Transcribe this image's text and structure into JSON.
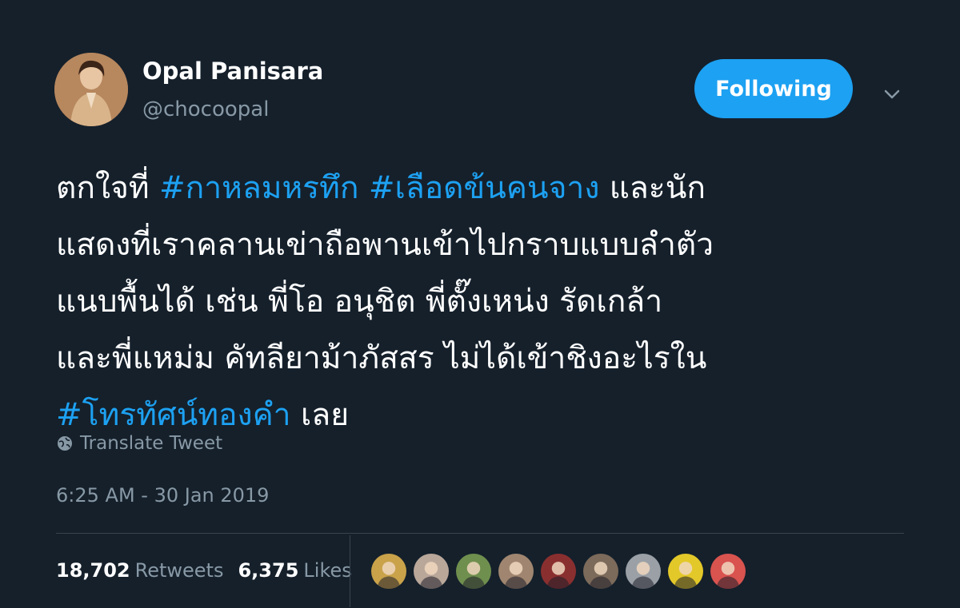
{
  "author": {
    "name": "Opal Panisara",
    "handle": "@chocoopal",
    "avatar_icon": "profile-photo"
  },
  "follow_button": {
    "label": "Following",
    "color": "#1da1f2"
  },
  "menu": {
    "icon": "chevron-down-icon"
  },
  "tweet": {
    "line1": {
      "text_a": "ตกใจที่ ",
      "tag_a": "#กาหลมหรทึก",
      "sep": " ",
      "tag_b": "#เลือดข้นคนจาง",
      "text_b": " และนัก"
    },
    "line2": "แสดงที่เราคลานเข่าถือพานเข้าไปกราบแบบลำตัว",
    "line3": "แนบพื้นได้ เช่น พี่โอ อนุชิต  พี่ตั๊งเหน่ง รัดเกล้า",
    "line4": "และพี่แหม่ม คัทลียาม้าภัสสร ไม่ได้เข้าชิงอะไรใน",
    "line5": {
      "tag": "#โทรทัศน์ทองคำ",
      "text": " เลย"
    }
  },
  "translate": {
    "label": "Translate Tweet",
    "icon": "globe-icon"
  },
  "timestamp": "6:25 AM - 30 Jan 2019",
  "stats": {
    "retweets_count": "18,702",
    "retweets_label": "Retweets",
    "likes_count": "6,375",
    "likes_label": "Likes"
  },
  "likers": [
    {
      "icon": "user-avatar-1",
      "color": "#c9a24a"
    },
    {
      "icon": "user-avatar-2",
      "color": "#b9a79a"
    },
    {
      "icon": "user-avatar-3",
      "color": "#6f8f4e"
    },
    {
      "icon": "user-avatar-4",
      "color": "#a08670"
    },
    {
      "icon": "user-avatar-5",
      "color": "#8a2f2f"
    },
    {
      "icon": "user-avatar-6",
      "color": "#7c6a5a"
    },
    {
      "icon": "user-avatar-7",
      "color": "#9aa0a6"
    },
    {
      "icon": "user-avatar-8",
      "color": "#e3c829"
    },
    {
      "icon": "user-avatar-9",
      "color": "#d9534f"
    }
  ],
  "colors": {
    "background": "#15202b",
    "link": "#1da1f2",
    "secondary_text": "#8899a6",
    "divider": "#38444d"
  }
}
